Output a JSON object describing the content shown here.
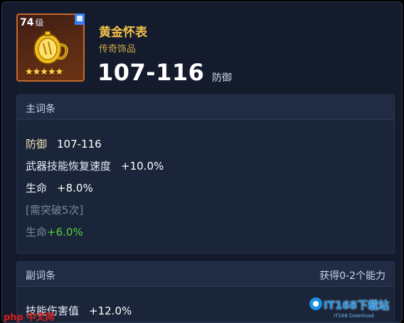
{
  "item": {
    "level": "74",
    "level_unit": "级",
    "name": "黄金怀表",
    "rarity": "传奇饰品",
    "stars": "★★★★★",
    "stat_value": "107-116",
    "stat_unit": "防御"
  },
  "main_affix": {
    "title": "主词条",
    "rows": [
      {
        "label": "防御",
        "value": "107-116"
      },
      {
        "label": "武器技能恢复速度",
        "value": "+10.0%"
      },
      {
        "label": "生命",
        "value": "+8.0%"
      },
      {
        "label": "[需突破5次]",
        "value": ""
      },
      {
        "label": "生命",
        "value": "+6.0%"
      }
    ]
  },
  "sub_affix": {
    "title": "副词条",
    "right_text": "获得0-2个能力",
    "rows": [
      {
        "label": "技能伤害值",
        "value": "+12.0%"
      }
    ]
  },
  "watermarks": {
    "left": "php 中文网",
    "right": "IT168下载站",
    "right_sub": "IT168 Download"
  },
  "colors": {
    "panel_bg": "#131b2c",
    "item_name": "#f3c24b",
    "rarity": "#d2a64a",
    "bonus_green": "#52d23e",
    "dim_text": "#7b8699"
  }
}
